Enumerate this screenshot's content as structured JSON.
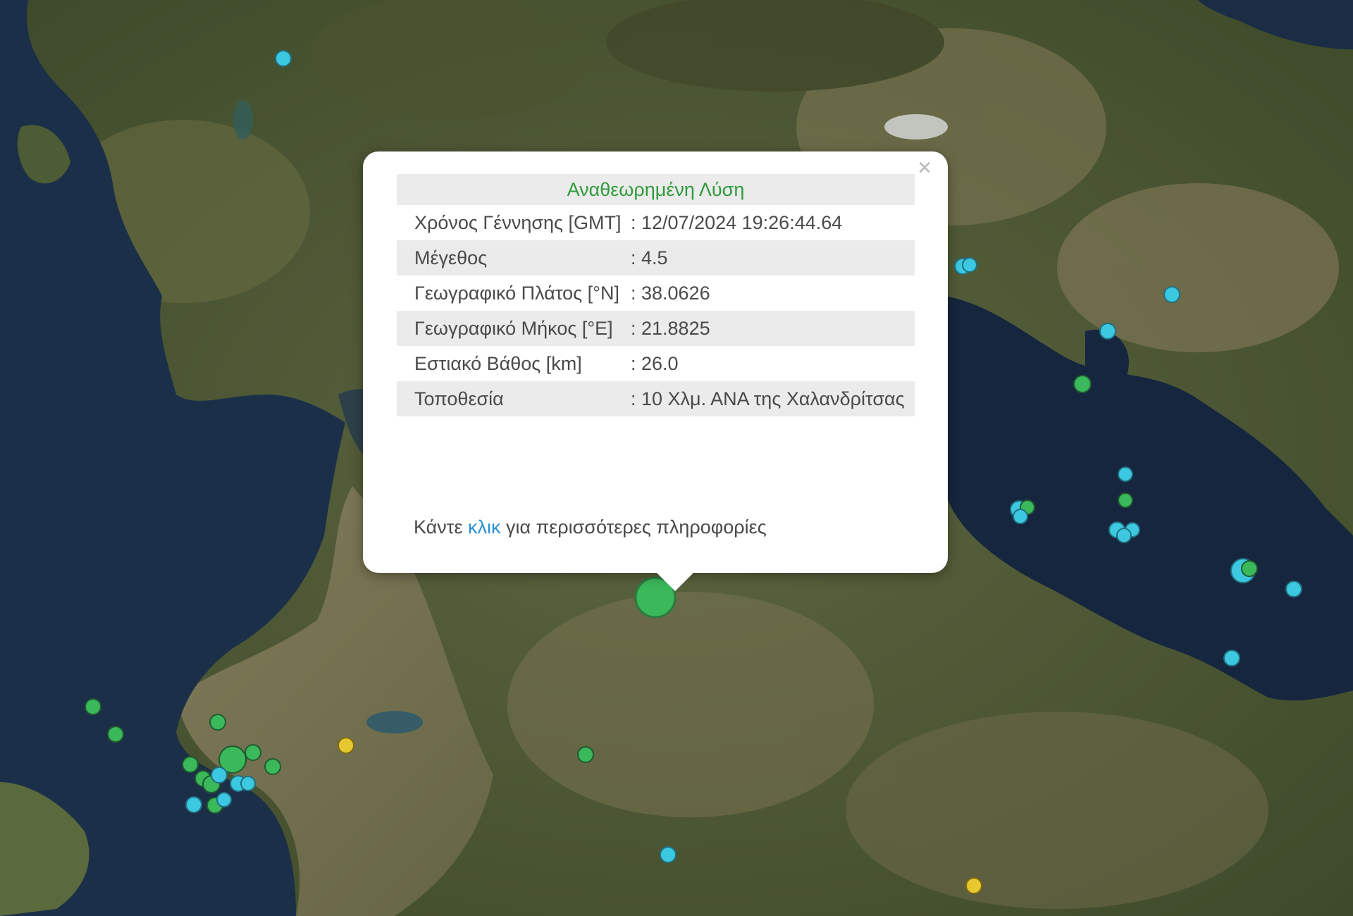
{
  "popup": {
    "title": "Αναθεωρημένη Λύση",
    "close_symbol": "×",
    "rows": [
      {
        "label": "Χρόνος Γέννησης [GMT]",
        "value": ": 12/07/2024 19:26:44.64"
      },
      {
        "label": "Μέγεθος",
        "value": ": 4.5"
      },
      {
        "label": "Γεωγραφικό Πλάτος [°N]",
        "value": ": 38.0626"
      },
      {
        "label": "Γεωγραφικό Μήκος [°E]",
        "value": ": 21.8825"
      },
      {
        "label": "Εστιακό Βάθος [km]",
        "value": ": 26.0"
      },
      {
        "label": "Τοποθεσία",
        "value": ": 10 Χλμ. ΑΝΑ της Χαλανδρίτσας"
      }
    ],
    "more_prefix": "Κάντε",
    "more_link": "κλικ",
    "more_suffix": "για περισσότερες πληροφορίες"
  },
  "colors": {
    "land": "#4e5a36",
    "land_light": "#7c7656",
    "sea": "#1b3048",
    "quake_green": "#3ab85a",
    "quake_cyan": "#3cc8e0",
    "quake_yellow": "#e8c830",
    "popup_title": "#2f9b3c",
    "link": "#2a8fd0"
  }
}
